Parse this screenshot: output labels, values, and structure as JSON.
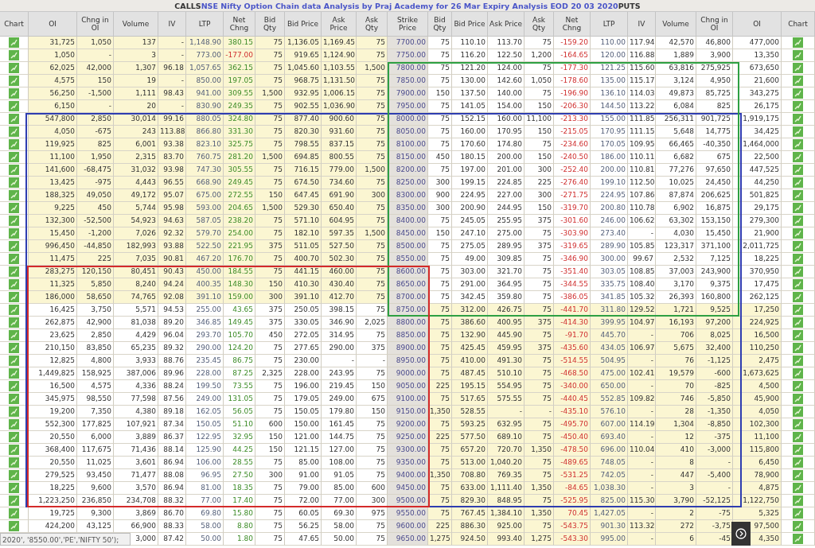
{
  "title": {
    "left": "CALLS",
    "main": "NSE Nifty Option Chain data Analysis by Praj Academy for 26 Mar Expiry Analysis EOD 20 03 2020",
    "right": "PUTS"
  },
  "columns": [
    "Chart",
    "OI",
    "Chng in OI",
    "Volume",
    "IV",
    "LTP",
    "Net Chng",
    "Bid Qty",
    "Bid Price",
    "Ask Price",
    "Ask Qty",
    "Strike Price",
    "Bid Qty",
    "Bid Price",
    "Ask Price",
    "Ask Qty",
    "Net Chng",
    "LTP",
    "IV",
    "Volume",
    "Chng in OI",
    "OI",
    "Chart"
  ],
  "rows": [
    {
      "call": [
        "31,725",
        "1,050",
        "137",
        "-",
        "1,148.90",
        "380.15",
        "75",
        "1,136.05",
        "1,169.45",
        "75"
      ],
      "call_down": false,
      "call_itm": true,
      "strike": "7700.00",
      "put": [
        "75",
        "110.10",
        "113.70",
        "75",
        "-159.20",
        "110.00",
        "117.94",
        "42,570",
        "46,800",
        "477,000"
      ],
      "put_down": true,
      "put_itm": false
    },
    {
      "call": [
        "1,050",
        "-",
        "3",
        "-",
        "773.00",
        "-177.00",
        "75",
        "919.65",
        "1,124.90",
        "75"
      ],
      "call_down": true,
      "call_itm": true,
      "strike": "7750.00",
      "put": [
        "75",
        "116.20",
        "122.50",
        "1,200",
        "-164.65",
        "120.00",
        "116.88",
        "1,889",
        "3,900",
        "13,350"
      ],
      "put_down": true,
      "put_itm": false
    },
    {
      "call": [
        "62,025",
        "42,000",
        "1,307",
        "96.18",
        "1,057.65",
        "362.15",
        "75",
        "1,045.60",
        "1,103.55",
        "1,500"
      ],
      "call_down": false,
      "call_itm": true,
      "strike": "7800.00",
      "put": [
        "75",
        "121.20",
        "124.00",
        "75",
        "-177.30",
        "121.25",
        "115.60",
        "63,816",
        "275,925",
        "673,650"
      ],
      "put_down": true,
      "put_itm": false
    },
    {
      "call": [
        "4,575",
        "150",
        "19",
        "-",
        "850.00",
        "197.05",
        "75",
        "968.75",
        "1,131.50",
        "75"
      ],
      "call_down": false,
      "call_itm": true,
      "strike": "7850.00",
      "put": [
        "75",
        "130.00",
        "142.60",
        "1,050",
        "-178.60",
        "135.00",
        "115.17",
        "3,124",
        "4,950",
        "21,600"
      ],
      "put_down": true,
      "put_itm": false
    },
    {
      "call": [
        "56,250",
        "-1,500",
        "1,111",
        "98.43",
        "941.00",
        "309.55",
        "1,500",
        "932.95",
        "1,006.15",
        "75"
      ],
      "call_down": false,
      "call_itm": true,
      "strike": "7900.00",
      "put": [
        "150",
        "137.50",
        "140.00",
        "75",
        "-196.90",
        "136.10",
        "114.03",
        "49,873",
        "85,725",
        "343,275"
      ],
      "put_down": true,
      "put_itm": false
    },
    {
      "call": [
        "6,150",
        "-",
        "20",
        "-",
        "830.90",
        "249.35",
        "75",
        "902.55",
        "1,036.90",
        "75"
      ],
      "call_down": false,
      "call_itm": true,
      "strike": "7950.00",
      "put": [
        "75",
        "141.05",
        "154.00",
        "150",
        "-206.30",
        "144.50",
        "113.22",
        "6,084",
        "825",
        "26,175"
      ],
      "put_down": true,
      "put_itm": false
    },
    {
      "call": [
        "547,800",
        "2,850",
        "30,014",
        "99.16",
        "880.05",
        "324.80",
        "75",
        "877.40",
        "900.60",
        "75"
      ],
      "call_down": false,
      "call_itm": true,
      "strike": "8000.00",
      "put": [
        "75",
        "152.15",
        "160.00",
        "11,100",
        "-213.30",
        "155.00",
        "111.85",
        "256,311",
        "901,725",
        "1,919,175"
      ],
      "put_down": true,
      "put_itm": false
    },
    {
      "call": [
        "4,050",
        "-675",
        "243",
        "113.88",
        "866.80",
        "331.30",
        "75",
        "820.30",
        "931.60",
        "75"
      ],
      "call_down": false,
      "call_itm": true,
      "strike": "8050.00",
      "put": [
        "75",
        "160.00",
        "170.95",
        "150",
        "-215.05",
        "170.95",
        "111.15",
        "5,648",
        "14,775",
        "34,425"
      ],
      "put_down": true,
      "put_itm": false
    },
    {
      "call": [
        "119,925",
        "825",
        "6,001",
        "93.38",
        "823.10",
        "325.75",
        "75",
        "798.55",
        "837.15",
        "75"
      ],
      "call_down": false,
      "call_itm": true,
      "strike": "8100.00",
      "put": [
        "75",
        "170.60",
        "174.80",
        "75",
        "-234.60",
        "170.05",
        "109.95",
        "66,465",
        "-40,350",
        "1,464,000"
      ],
      "put_down": true,
      "put_itm": false
    },
    {
      "call": [
        "11,100",
        "1,950",
        "2,315",
        "83.70",
        "760.75",
        "281.20",
        "1,500",
        "694.85",
        "800.55",
        "75"
      ],
      "call_down": false,
      "call_itm": true,
      "strike": "8150.00",
      "put": [
        "450",
        "180.15",
        "200.00",
        "150",
        "-240.50",
        "186.00",
        "110.11",
        "6,682",
        "675",
        "22,500"
      ],
      "put_down": true,
      "put_itm": false
    },
    {
      "call": [
        "141,600",
        "-68,475",
        "31,032",
        "93.98",
        "747.30",
        "305.55",
        "75",
        "716.15",
        "779.00",
        "1,500"
      ],
      "call_down": false,
      "call_itm": true,
      "strike": "8200.00",
      "put": [
        "75",
        "197.00",
        "201.00",
        "300",
        "-252.40",
        "200.00",
        "110.81",
        "77,276",
        "97,650",
        "447,525"
      ],
      "put_down": true,
      "put_itm": false
    },
    {
      "call": [
        "13,425",
        "-975",
        "4,443",
        "96.55",
        "668.90",
        "249.45",
        "75",
        "674.50",
        "734.60",
        "75"
      ],
      "call_down": false,
      "call_itm": true,
      "strike": "8250.00",
      "put": [
        "300",
        "199.15",
        "224.85",
        "225",
        "-276.40",
        "199.10",
        "112.50",
        "10,025",
        "24,450",
        "44,250"
      ],
      "put_down": true,
      "put_itm": false
    },
    {
      "call": [
        "188,325",
        "49,050",
        "49,172",
        "95.07",
        "675.00",
        "272.55",
        "150",
        "647.45",
        "691.90",
        "300"
      ],
      "call_down": false,
      "call_itm": true,
      "strike": "8300.00",
      "put": [
        "900",
        "224.95",
        "227.00",
        "300",
        "-271.75",
        "224.95",
        "107.86",
        "87,874",
        "206,625",
        "501,825"
      ],
      "put_down": true,
      "put_itm": false
    },
    {
      "call": [
        "9,225",
        "450",
        "5,744",
        "95.98",
        "593.00",
        "204.65",
        "1,500",
        "529.30",
        "650.40",
        "75"
      ],
      "call_down": false,
      "call_itm": true,
      "strike": "8350.00",
      "put": [
        "300",
        "200.90",
        "244.95",
        "150",
        "-319.70",
        "200.80",
        "110.78",
        "6,902",
        "16,875",
        "29,175"
      ],
      "put_down": true,
      "put_itm": false
    },
    {
      "call": [
        "132,300",
        "-52,500",
        "54,923",
        "94.63",
        "587.05",
        "238.20",
        "75",
        "571.10",
        "604.95",
        "75"
      ],
      "call_down": false,
      "call_itm": true,
      "strike": "8400.00",
      "put": [
        "75",
        "245.05",
        "255.95",
        "375",
        "-301.60",
        "246.00",
        "106.62",
        "63,302",
        "153,150",
        "279,300"
      ],
      "put_down": true,
      "put_itm": false
    },
    {
      "call": [
        "15,450",
        "-1,200",
        "7,026",
        "92.32",
        "579.70",
        "254.00",
        "75",
        "182.10",
        "597.35",
        "1,500"
      ],
      "call_down": false,
      "call_itm": true,
      "strike": "8450.00",
      "put": [
        "150",
        "247.10",
        "275.00",
        "75",
        "-303.90",
        "273.40",
        "-",
        "4,030",
        "15,450",
        "21,900"
      ],
      "put_down": true,
      "put_itm": false
    },
    {
      "call": [
        "996,450",
        "-44,850",
        "182,993",
        "93.88",
        "522.50",
        "221.95",
        "375",
        "511.05",
        "527.50",
        "75"
      ],
      "call_down": false,
      "call_itm": true,
      "strike": "8500.00",
      "put": [
        "75",
        "275.05",
        "289.95",
        "375",
        "-319.65",
        "289.90",
        "105.85",
        "123,317",
        "371,100",
        "2,011,725"
      ],
      "put_down": true,
      "put_itm": false
    },
    {
      "call": [
        "11,475",
        "225",
        "7,035",
        "90.81",
        "467.20",
        "176.70",
        "75",
        "400.70",
        "502.30",
        "75"
      ],
      "call_down": false,
      "call_itm": true,
      "strike": "8550.00",
      "put": [
        "75",
        "49.00",
        "309.85",
        "75",
        "-346.90",
        "300.00",
        "99.67",
        "2,532",
        "7,125",
        "18,225"
      ],
      "put_down": true,
      "put_itm": false
    },
    {
      "call": [
        "283,275",
        "120,150",
        "80,451",
        "90.43",
        "450.00",
        "184.55",
        "75",
        "441.15",
        "460.00",
        "75"
      ],
      "call_down": false,
      "call_itm": true,
      "strike": "8600.00",
      "put": [
        "75",
        "303.00",
        "321.70",
        "75",
        "-351.40",
        "303.05",
        "108.85",
        "37,003",
        "243,900",
        "370,950"
      ],
      "put_down": true,
      "put_itm": false
    },
    {
      "call": [
        "11,325",
        "5,850",
        "8,240",
        "94.24",
        "400.35",
        "148.30",
        "150",
        "410.30",
        "430.40",
        "75"
      ],
      "call_down": false,
      "call_itm": true,
      "strike": "8650.00",
      "put": [
        "75",
        "291.00",
        "364.95",
        "75",
        "-344.55",
        "335.75",
        "108.40",
        "3,170",
        "9,375",
        "17,475"
      ],
      "put_down": true,
      "put_itm": false
    },
    {
      "call": [
        "186,000",
        "58,650",
        "74,765",
        "92.08",
        "391.10",
        "159.00",
        "300",
        "391.10",
        "412.70",
        "75"
      ],
      "call_down": false,
      "call_itm": true,
      "strike": "8700.00",
      "put": [
        "75",
        "342.45",
        "359.80",
        "75",
        "-386.05",
        "341.85",
        "105.32",
        "26,393",
        "160,800",
        "262,125"
      ],
      "put_down": true,
      "put_itm": false
    },
    {
      "call": [
        "16,425",
        "3,750",
        "5,571",
        "94.53",
        "255.00",
        "43.65",
        "375",
        "250.05",
        "398.15",
        "75"
      ],
      "call_down": false,
      "call_itm": false,
      "strike": "8750.00",
      "put": [
        "75",
        "312.00",
        "426.75",
        "75",
        "-441.70",
        "311.80",
        "129.52",
        "1,721",
        "9,525",
        "17,250"
      ],
      "put_down": true,
      "put_itm": true
    },
    {
      "call": [
        "262,875",
        "42,900",
        "81,038",
        "89.20",
        "346.85",
        "149.45",
        "375",
        "330.05",
        "346.90",
        "2,025"
      ],
      "call_down": false,
      "call_itm": false,
      "strike": "8800.00",
      "put": [
        "75",
        "386.60",
        "400.95",
        "375",
        "-414.30",
        "399.95",
        "104.97",
        "16,193",
        "97,200",
        "224,925"
      ],
      "put_down": true,
      "put_itm": true
    },
    {
      "call": [
        "23,625",
        "2,850",
        "4,429",
        "96.04",
        "293.70",
        "105.70",
        "450",
        "272.05",
        "314.95",
        "75"
      ],
      "call_down": false,
      "call_itm": false,
      "strike": "8850.00",
      "put": [
        "75",
        "132.90",
        "445.90",
        "75",
        "-91.70",
        "445.70",
        "-",
        "706",
        "8,025",
        "16,500"
      ],
      "put_down": true,
      "put_itm": true
    },
    {
      "call": [
        "210,150",
        "83,850",
        "65,235",
        "89.32",
        "290.00",
        "124.20",
        "75",
        "277.65",
        "290.00",
        "375"
      ],
      "call_down": false,
      "call_itm": false,
      "strike": "8900.00",
      "put": [
        "75",
        "425.45",
        "459.95",
        "375",
        "-435.60",
        "434.05",
        "106.97",
        "5,675",
        "32,400",
        "110,250"
      ],
      "put_down": true,
      "put_itm": true
    },
    {
      "call": [
        "12,825",
        "4,800",
        "3,933",
        "88.76",
        "235.45",
        "86.75",
        "75",
        "230.00",
        "-",
        "-"
      ],
      "call_down": false,
      "call_itm": false,
      "strike": "8950.00",
      "put": [
        "75",
        "410.00",
        "491.30",
        "75",
        "-514.55",
        "504.95",
        "-",
        "76",
        "-1,125",
        "2,475"
      ],
      "put_down": true,
      "put_itm": true
    },
    {
      "call": [
        "1,449,825",
        "158,925",
        "387,006",
        "89.96",
        "228.00",
        "87.25",
        "2,325",
        "228.00",
        "243.95",
        "75"
      ],
      "call_down": false,
      "call_itm": false,
      "strike": "9000.00",
      "put": [
        "75",
        "487.45",
        "510.10",
        "75",
        "-468.50",
        "475.00",
        "102.41",
        "19,579",
        "-600",
        "1,673,625"
      ],
      "put_down": true,
      "put_itm": true
    },
    {
      "call": [
        "16,500",
        "4,575",
        "4,336",
        "88.24",
        "199.50",
        "73.55",
        "75",
        "196.00",
        "219.45",
        "150"
      ],
      "call_down": false,
      "call_itm": false,
      "strike": "9050.00",
      "put": [
        "225",
        "195.15",
        "554.95",
        "75",
        "-340.00",
        "650.00",
        "-",
        "70",
        "-825",
        "4,500"
      ],
      "put_down": true,
      "put_itm": true
    },
    {
      "call": [
        "345,975",
        "98,550",
        "77,598",
        "87.56",
        "249.00",
        "131.05",
        "75",
        "179.05",
        "249.00",
        "675"
      ],
      "call_down": false,
      "call_itm": false,
      "strike": "9100.00",
      "put": [
        "75",
        "517.65",
        "575.55",
        "75",
        "-440.45",
        "552.85",
        "109.82",
        "746",
        "-5,850",
        "45,900"
      ],
      "put_down": true,
      "put_itm": true
    },
    {
      "call": [
        "19,200",
        "7,350",
        "4,380",
        "89.18",
        "162.05",
        "56.05",
        "75",
        "150.05",
        "179.80",
        "150"
      ],
      "call_down": false,
      "call_itm": false,
      "strike": "9150.00",
      "put": [
        "1,350",
        "528.55",
        "-",
        "-",
        "-435.10",
        "576.10",
        "-",
        "28",
        "-1,350",
        "4,050"
      ],
      "put_down": true,
      "put_itm": true
    },
    {
      "call": [
        "552,300",
        "177,825",
        "107,921",
        "87.34",
        "150.05",
        "51.10",
        "600",
        "150.00",
        "161.45",
        "75"
      ],
      "call_down": false,
      "call_itm": false,
      "strike": "9200.00",
      "put": [
        "75",
        "593.25",
        "632.95",
        "75",
        "-495.70",
        "607.00",
        "114.19",
        "1,304",
        "-8,850",
        "102,300"
      ],
      "put_down": true,
      "put_itm": true
    },
    {
      "call": [
        "20,550",
        "6,000",
        "3,889",
        "86.37",
        "122.95",
        "32.95",
        "150",
        "121.00",
        "144.75",
        "75"
      ],
      "call_down": false,
      "call_itm": false,
      "strike": "9250.00",
      "put": [
        "225",
        "577.50",
        "689.10",
        "75",
        "-450.40",
        "693.40",
        "-",
        "12",
        "-375",
        "11,100"
      ],
      "put_down": true,
      "put_itm": true
    },
    {
      "call": [
        "368,400",
        "117,675",
        "71,436",
        "88.14",
        "125.90",
        "44.25",
        "150",
        "121.15",
        "127.00",
        "75"
      ],
      "call_down": false,
      "call_itm": false,
      "strike": "9300.00",
      "put": [
        "75",
        "657.20",
        "720.70",
        "1,350",
        "-478.50",
        "696.00",
        "110.04",
        "410",
        "-3,000",
        "115,800"
      ],
      "put_down": true,
      "put_itm": true
    },
    {
      "call": [
        "20,550",
        "11,025",
        "3,601",
        "86.94",
        "106.00",
        "28.55",
        "75",
        "85.00",
        "108.00",
        "75"
      ],
      "call_down": false,
      "call_itm": false,
      "strike": "9350.00",
      "put": [
        "75",
        "513.00",
        "1,040.20",
        "75",
        "-489.65",
        "748.05",
        "-",
        "8",
        "-",
        "6,450"
      ],
      "put_down": true,
      "put_itm": true
    },
    {
      "call": [
        "279,525",
        "93,450",
        "71,477",
        "88.08",
        "96.95",
        "27.50",
        "300",
        "91.00",
        "91.05",
        "75"
      ],
      "call_down": false,
      "call_itm": false,
      "strike": "9400.00",
      "put": [
        "1,350",
        "708.80",
        "769.35",
        "75",
        "-531.25",
        "742.05",
        "-",
        "447",
        "-5,400",
        "78,900"
      ],
      "put_down": true,
      "put_itm": true
    },
    {
      "call": [
        "18,225",
        "9,600",
        "3,570",
        "86.94",
        "81.00",
        "18.35",
        "75",
        "79.00",
        "85.00",
        "600"
      ],
      "call_down": false,
      "call_itm": false,
      "strike": "9450.00",
      "put": [
        "75",
        "633.00",
        "1,111.40",
        "1,350",
        "-84.65",
        "1,038.30",
        "-",
        "3",
        "-",
        "4,875"
      ],
      "put_down": true,
      "put_itm": true
    },
    {
      "call": [
        "1,223,250",
        "236,850",
        "234,708",
        "88.32",
        "77.00",
        "17.40",
        "75",
        "72.00",
        "77.00",
        "300"
      ],
      "call_down": false,
      "call_itm": false,
      "strike": "9500.00",
      "put": [
        "75",
        "829.30",
        "848.95",
        "75",
        "-525.95",
        "825.00",
        "115.30",
        "3,790",
        "-52,125",
        "1,122,750"
      ],
      "put_down": true,
      "put_itm": true
    },
    {
      "call": [
        "19,725",
        "9,300",
        "3,869",
        "86.70",
        "69.80",
        "15.80",
        "75",
        "60.05",
        "69.30",
        "975"
      ],
      "call_down": false,
      "call_itm": false,
      "strike": "9550.00",
      "put": [
        "75",
        "767.45",
        "1,384.10",
        "1,350",
        "70.45",
        "1,427.05",
        "-",
        "2",
        "-75",
        "5,325"
      ],
      "put_down": true,
      "put_itm": true
    },
    {
      "call": [
        "424,200",
        "43,125",
        "66,900",
        "88.33",
        "58.00",
        "8.80",
        "75",
        "56.25",
        "58.00",
        "75"
      ],
      "call_down": false,
      "call_itm": false,
      "strike": "9600.00",
      "put": [
        "225",
        "886.30",
        "925.00",
        "75",
        "-543.75",
        "901.30",
        "113.32",
        "272",
        "-3,75",
        "97,500"
      ],
      "put_down": true,
      "put_itm": true
    },
    {
      "call": [
        "3,000",
        "87.42",
        "50.00",
        "1.80",
        "75",
        "47.65",
        "50.00",
        "75"
      ],
      "call_down": false,
      "call_itm": false,
      "strike": "9650.00",
      "put": [
        "1,275",
        "924.50",
        "993.40",
        "1,275",
        "-543.30",
        "995.00",
        "-",
        "6",
        "-45",
        "4,350"
      ],
      "put_down": true,
      "put_itm": true
    }
  ],
  "frames": [
    {
      "color": "#2e3db0",
      "kind": "wide"
    },
    {
      "color": "#2ea043",
      "kind": "puts"
    },
    {
      "color": "#d42a2a",
      "kind": "calls"
    }
  ],
  "tooltip": "2020', '8550.00','PE','NIFTY 50');"
}
